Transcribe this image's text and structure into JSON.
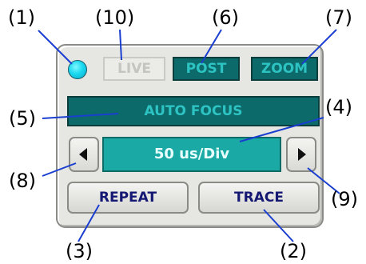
{
  "panel": {
    "live_label": "LIVE",
    "post_label": "POST",
    "zoom_label": "ZOOM",
    "auto_focus_label": "AUTO FOCUS",
    "time_base": "50 us/Div",
    "repeat_label": "REPEAT",
    "trace_label": "TRACE"
  },
  "callouts": {
    "c1": "(1)",
    "c2": "(2)",
    "c3": "(3)",
    "c4": "(4)",
    "c5": "(5)",
    "c6": "(6)",
    "c7": "(7)",
    "c8": "(8)",
    "c9": "(9)",
    "c10": "(10)"
  },
  "colors": {
    "led": "#1ad9f0",
    "dark_teal": "#0d6a6a",
    "dark_text": "#2ec3c3",
    "time_bg": "#1aa9a4",
    "button_text": "#151873"
  }
}
